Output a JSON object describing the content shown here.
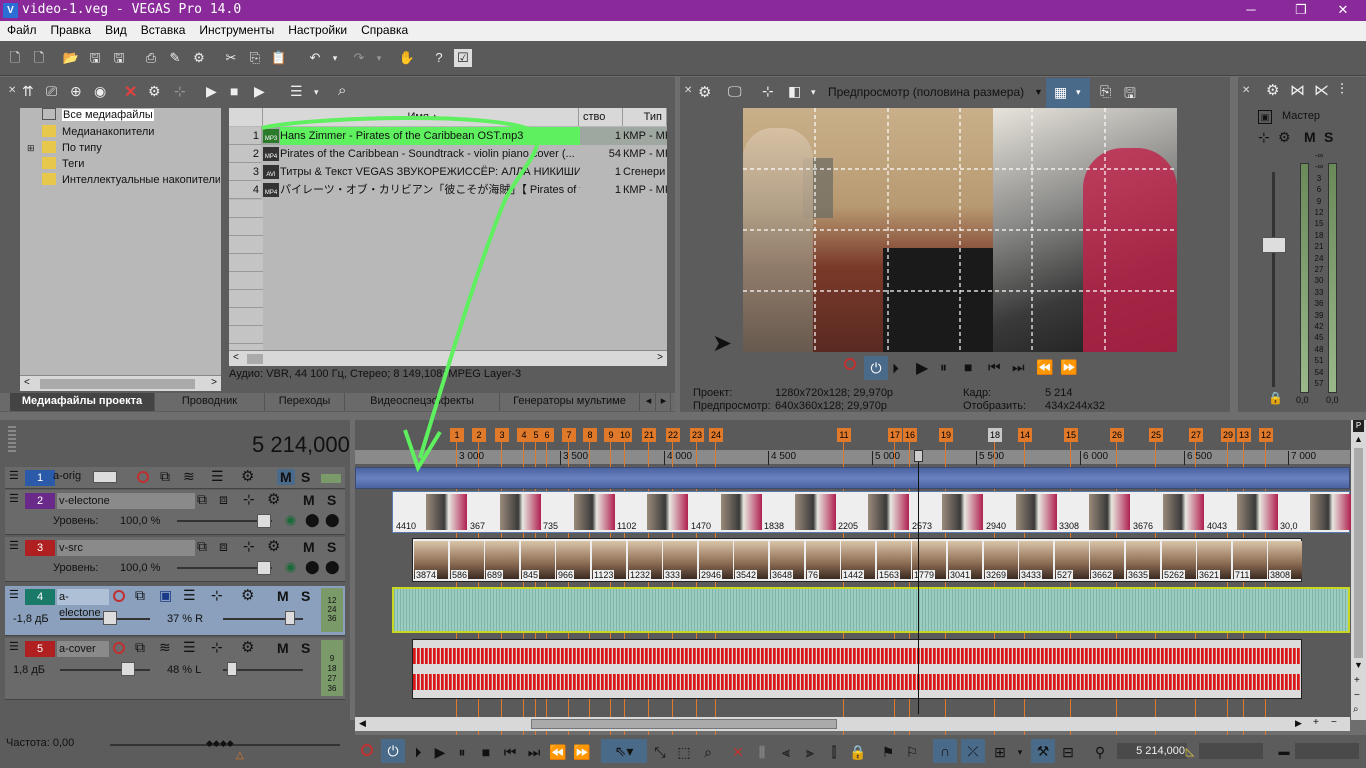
{
  "window": {
    "title": "video-1.veg - VEGAS Pro 14.0",
    "logo": "V"
  },
  "menu": [
    "Файл",
    "Правка",
    "Вид",
    "Вставка",
    "Инструменты",
    "Настройки",
    "Справка"
  ],
  "explorer": {
    "tree": [
      "Все медиафайлы",
      "Медианакопители",
      "По типу",
      "Теги",
      "Интеллектуальные накопители"
    ],
    "columns": {
      "name": "Имя",
      "count": "ство обр",
      "type": "Тип"
    },
    "files": [
      {
        "num": "1",
        "icon": "MP3",
        "name": "Hans Zimmer - Pirates of the Caribbean OST.mp3",
        "count": "1",
        "type": "КМР - МР"
      },
      {
        "num": "2",
        "icon": "MP4",
        "name": "Pirates of the Caribbean - Soundtrack - violin piano cover (...",
        "count": "54",
        "type": "КМР - МР"
      },
      {
        "num": "3",
        "icon": "AVI",
        "name": "Титры & Текст VEGAS ЗВУКОРЕЖИССЁР: АЛЛА НИКИШИНА",
        "count": "1",
        "type": "Сгенери"
      },
      {
        "num": "4",
        "icon": "MP4",
        "name": "パイレーツ・オブ・カリビアン「彼こそが海賊」【 Pirates of the C...",
        "count": "1",
        "type": "КМР - МР"
      }
    ],
    "info": "Аудио: VBR, 44 100 Гц, Стерео; 8 149,108; MPEG Layer-3",
    "tabs": [
      "Медиафайлы проекта",
      "Проводник",
      "Переходы",
      "Видеоспецэффекты",
      "Генераторы мультиме"
    ]
  },
  "preview": {
    "mode": "Предпросмотр (половина размера)",
    "project_label": "Проект:",
    "project_value": "1280x720x128; 29,970p",
    "preview_label": "Предпросмотр:",
    "preview_value": "640x360x128; 29,970p",
    "frame_label": "Кадр:",
    "frame_value": "5 214",
    "display_label": "Отобразить:",
    "display_value": "434x244x32"
  },
  "mixer": {
    "title": "Мастер",
    "m": "M",
    "s": "S",
    "scale": [
      "-∞",
      "-∞",
      "3",
      "6",
      "9",
      "12",
      "15",
      "18",
      "21",
      "24",
      "27",
      "30",
      "33",
      "36",
      "39",
      "42",
      "45",
      "48",
      "51",
      "54",
      "57"
    ],
    "left_val": "0,0",
    "right_val": "0,0"
  },
  "timecode": "5 214,000",
  "tracks": [
    {
      "num": "1",
      "name": "a-orig",
      "color": "#2a5aa8"
    },
    {
      "num": "2",
      "name": "v-electone",
      "color": "#6a2a8a",
      "level_label": "Уровень:",
      "level": "100,0 %"
    },
    {
      "num": "3",
      "name": "v-src",
      "color": "#b02020",
      "level_label": "Уровень:",
      "level": "100,0 %"
    },
    {
      "num": "4",
      "name": "a-electone",
      "color": "#1a7a6a",
      "vol": "-1,8 дБ",
      "pan": "37 % R"
    },
    {
      "num": "5",
      "name": "a-cover",
      "color": "#b02020",
      "vol": "1,8 дБ",
      "pan": "48 % L"
    }
  ],
  "ruler": [
    "3 000",
    "3 500",
    "4 000",
    "4 500",
    "5 000",
    "5 500",
    "6 000",
    "6 500",
    "7 000"
  ],
  "markers": [
    "1",
    "2",
    "3",
    "4",
    "5",
    "6",
    "7",
    "8",
    "9",
    "10",
    "21",
    "22",
    "23",
    "24",
    "11",
    "17",
    "16",
    "19",
    "18",
    "14",
    "15",
    "26",
    "25",
    "27",
    "29",
    "13",
    "12"
  ],
  "v_electone_frames": [
    "4410",
    "367",
    "735",
    "1102",
    "1470",
    "1838",
    "2205",
    "2573",
    "2940",
    "3308",
    "3676",
    "4043",
    "30,0"
  ],
  "v_src_frames": [
    "3874",
    "586",
    "689",
    "845",
    "966",
    "1123",
    "1232",
    "333",
    "2946",
    "3542",
    "3648",
    "76",
    "1442",
    "1563",
    "1779",
    "3041",
    "3269",
    "3433",
    "527",
    "3662",
    "3635",
    "5262",
    "3621",
    "711",
    "3808"
  ],
  "status": {
    "rate": "Частота: 0,00"
  },
  "transport_timecode": "5 214,000"
}
